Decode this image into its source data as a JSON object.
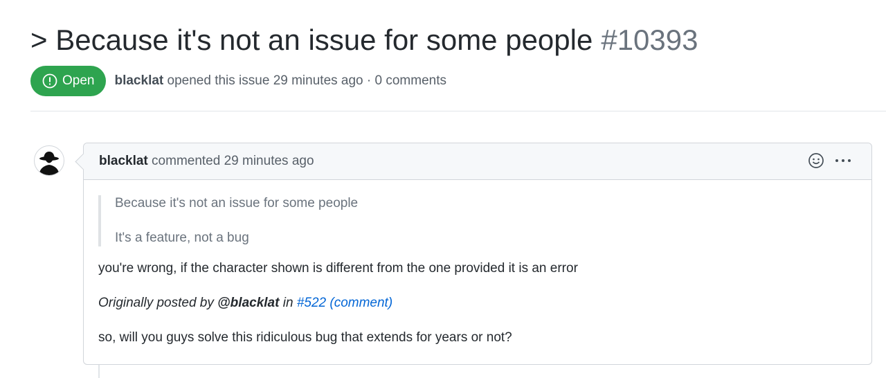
{
  "issue": {
    "title": "> Because it's not an issue for some people",
    "number": "#10393",
    "state_label": "Open",
    "author": "blacklat",
    "opened_text": "opened this issue 29 minutes ago · 0 comments"
  },
  "comment": {
    "author": "blacklat",
    "time_text": "commented 29 minutes ago",
    "quote_lines": [
      "Because it's not an issue for some people",
      "It's a feature, not a bug"
    ],
    "reply": "you're wrong, if the character shown is different from the one provided it is an error",
    "attribution": {
      "prefix": "Originally posted by",
      "user": "@blacklat",
      "in_text": "in",
      "ref": "#522",
      "ref_comment": "(comment)"
    },
    "question": "so, will you guys solve this ridiculous bug that extends for years or not?"
  },
  "icons": {
    "state": "issue-opened-icon",
    "reaction": "smiley-icon",
    "more": "kebab-horizontal-icon",
    "avatar": "hat-silhouette-avatar"
  },
  "colors": {
    "open": "#2ea44f",
    "link": "#0366d6",
    "muted": "#6a737d",
    "text": "#24292e"
  }
}
